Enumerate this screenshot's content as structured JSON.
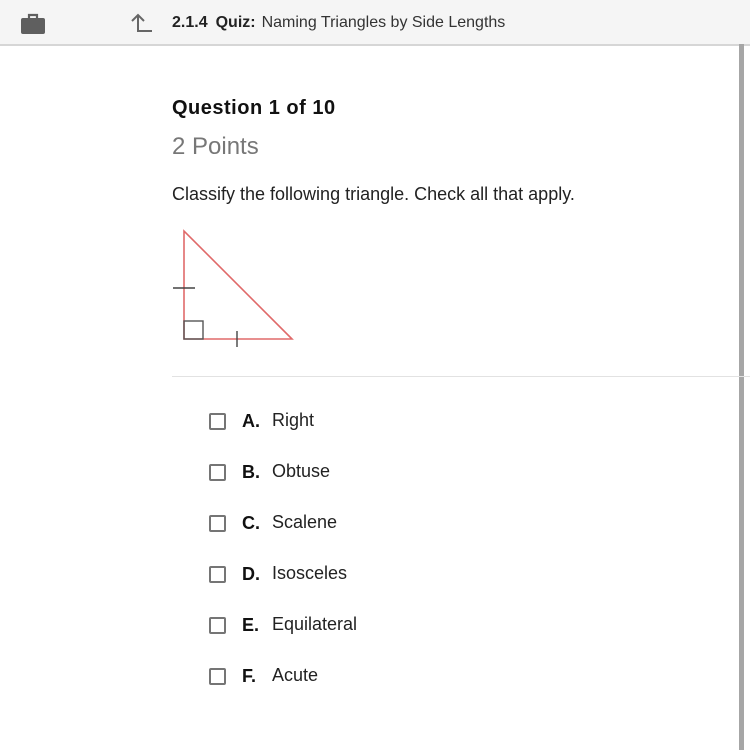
{
  "header": {
    "briefcase_icon": "briefcase-icon",
    "back_icon": "up-left-arrow-icon",
    "lesson_number": "2.1.4",
    "type_label": "Quiz:",
    "lesson_title": "Naming Triangles by Side Lengths"
  },
  "question": {
    "heading": "Question 1 of 10",
    "points": "2 Points",
    "prompt": "Classify the following triangle. Check all that apply.",
    "figure": {
      "description": "right triangle with two congruent legs (tick marks) and right-angle marker",
      "stroke_color": "#e06a6a",
      "mark_color": "#444444"
    }
  },
  "options": [
    {
      "letter": "A.",
      "label": "Right",
      "checked": false
    },
    {
      "letter": "B.",
      "label": "Obtuse",
      "checked": false
    },
    {
      "letter": "C.",
      "label": "Scalene",
      "checked": false
    },
    {
      "letter": "D.",
      "label": "Isosceles",
      "checked": false
    },
    {
      "letter": "E.",
      "label": "Equilateral",
      "checked": false
    },
    {
      "letter": "F.",
      "label": "Acute",
      "checked": false
    }
  ]
}
